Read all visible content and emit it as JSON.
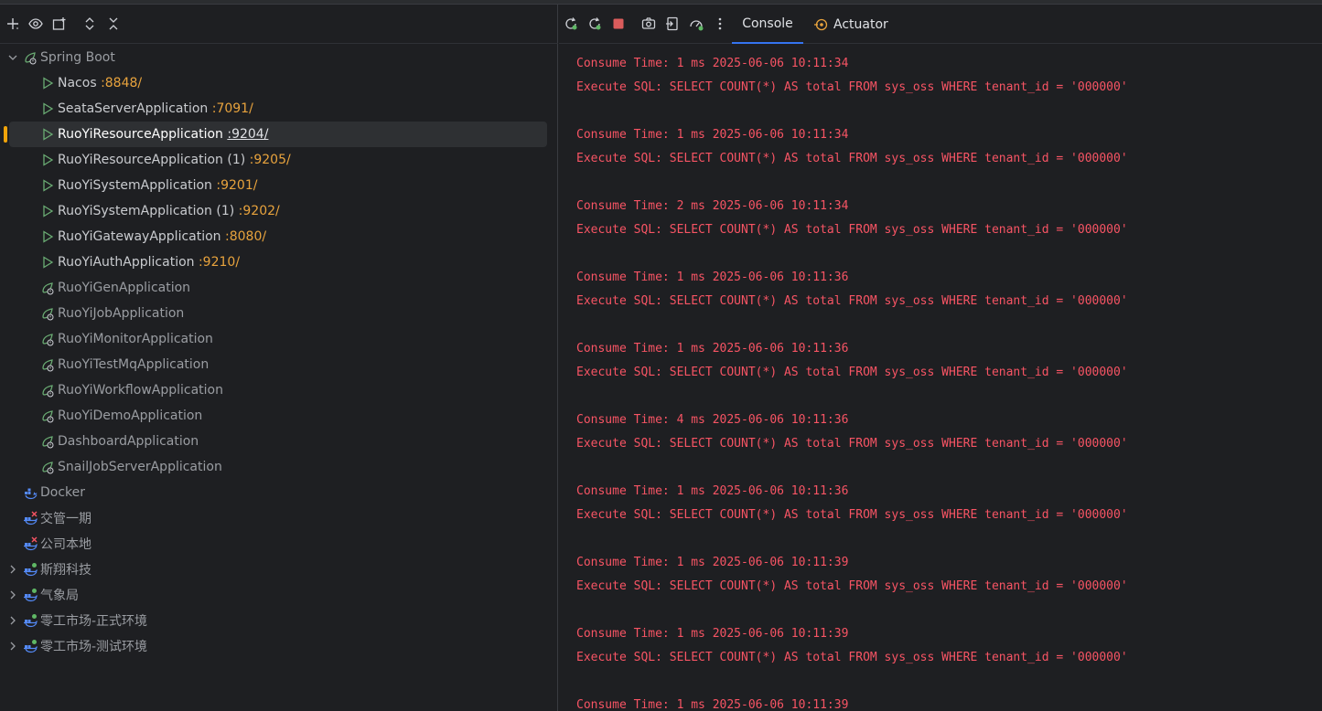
{
  "colors": {
    "accent": "#3574f0",
    "selection_marker": "#f0a30a",
    "port": "#e8a33d",
    "log_error": "#f75464"
  },
  "tree": {
    "spring_boot": {
      "label": "Spring Boot"
    },
    "running": [
      {
        "name": "Nacos",
        "port": ":8848/"
      },
      {
        "name": "SeataServerApplication",
        "port": ":7091/"
      },
      {
        "name": "RuoYiResourceApplication",
        "port": ":9204/"
      },
      {
        "name": "RuoYiResourceApplication (1)",
        "port": ":9205/"
      },
      {
        "name": "RuoYiSystemApplication",
        "port": ":9201/"
      },
      {
        "name": "RuoYiSystemApplication (1)",
        "port": ":9202/"
      },
      {
        "name": "RuoYiGatewayApplication",
        "port": ":8080/"
      },
      {
        "name": "RuoYiAuthApplication",
        "port": ":9210/"
      }
    ],
    "stopped": [
      "RuoYiGenApplication",
      "RuoYiJobApplication",
      "RuoYiMonitorApplication",
      "RuoYiTestMqApplication",
      "RuoYiWorkflowApplication",
      "RuoYiDemoApplication",
      "DashboardApplication",
      "SnailJobServerApplication"
    ],
    "docker": [
      {
        "label": "Docker",
        "expandable": false
      },
      {
        "label": "交管一期",
        "expandable": false
      },
      {
        "label": "公司本地",
        "expandable": false
      },
      {
        "label": "斯翔科技",
        "expandable": true
      },
      {
        "label": "气象局",
        "expandable": true
      },
      {
        "label": "零工市场-正式环境",
        "expandable": true
      },
      {
        "label": "零工市场-测试环境",
        "expandable": true
      }
    ]
  },
  "tabs": {
    "console": "Console",
    "actuator": "Actuator"
  },
  "console": {
    "entries": [
      {
        "time": "Consume Time: 1 ms 2025-06-06 10:11:34",
        "sql": "Execute SQL: SELECT COUNT(*) AS total FROM sys_oss WHERE tenant_id = '000000'"
      },
      {
        "time": "Consume Time: 1 ms 2025-06-06 10:11:34",
        "sql": "Execute SQL: SELECT COUNT(*) AS total FROM sys_oss WHERE tenant_id = '000000'"
      },
      {
        "time": "Consume Time: 2 ms 2025-06-06 10:11:34",
        "sql": "Execute SQL: SELECT COUNT(*) AS total FROM sys_oss WHERE tenant_id = '000000'"
      },
      {
        "time": "Consume Time: 1 ms 2025-06-06 10:11:36",
        "sql": "Execute SQL: SELECT COUNT(*) AS total FROM sys_oss WHERE tenant_id = '000000'"
      },
      {
        "time": "Consume Time: 1 ms 2025-06-06 10:11:36",
        "sql": "Execute SQL: SELECT COUNT(*) AS total FROM sys_oss WHERE tenant_id = '000000'"
      },
      {
        "time": "Consume Time: 4 ms 2025-06-06 10:11:36",
        "sql": "Execute SQL: SELECT COUNT(*) AS total FROM sys_oss WHERE tenant_id = '000000'"
      },
      {
        "time": "Consume Time: 1 ms 2025-06-06 10:11:36",
        "sql": "Execute SQL: SELECT COUNT(*) AS total FROM sys_oss WHERE tenant_id = '000000'"
      },
      {
        "time": "Consume Time: 1 ms 2025-06-06 10:11:39",
        "sql": "Execute SQL: SELECT COUNT(*) AS total FROM sys_oss WHERE tenant_id = '000000'"
      },
      {
        "time": "Consume Time: 1 ms 2025-06-06 10:11:39",
        "sql": "Execute SQL: SELECT COUNT(*) AS total FROM sys_oss WHERE tenant_id = '000000'"
      },
      {
        "time": "Consume Time: 1 ms 2025-06-06 10:11:39",
        "sql": ""
      }
    ]
  }
}
